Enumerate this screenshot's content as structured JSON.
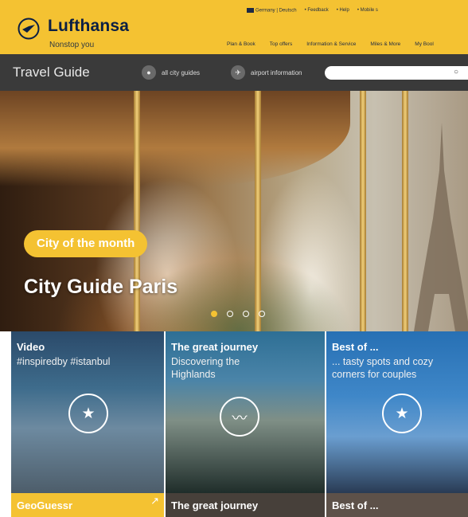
{
  "brand": {
    "name": "Lufthansa",
    "tagline": "Nonstop you"
  },
  "utility_nav": [
    "Germany | Deutsch",
    "• Feedback",
    "• Help",
    "• Mobile s"
  ],
  "main_nav": [
    "Plan & Book",
    "Top offers",
    "Information & Service",
    "Miles & More",
    "My Bool"
  ],
  "subbar": {
    "title": "Travel Guide",
    "city_guides": "all city guides",
    "airport_info": "airport information",
    "search_placeholder": ""
  },
  "hero": {
    "badge": "City of the month",
    "title": "City Guide Paris",
    "slides": 4,
    "active_slide": 1
  },
  "tiles": [
    {
      "title": "Video",
      "subtitle": "#inspiredby #istanbul",
      "icon": "star-icon"
    },
    {
      "title": "The great journey",
      "subtitle": "Discovering the Highlands",
      "icon": "wave-icon"
    },
    {
      "title": "Best of ...",
      "subtitle": "... tasty spots and cozy corners for couples",
      "icon": "star-icon"
    }
  ],
  "bottom_tiles": [
    "GeoGuessr",
    "The great journey",
    "Best of ..."
  ],
  "colors": {
    "brand_yellow": "#f4c232",
    "brand_navy": "#0b1f44",
    "subbar": "#3a3a3a"
  }
}
